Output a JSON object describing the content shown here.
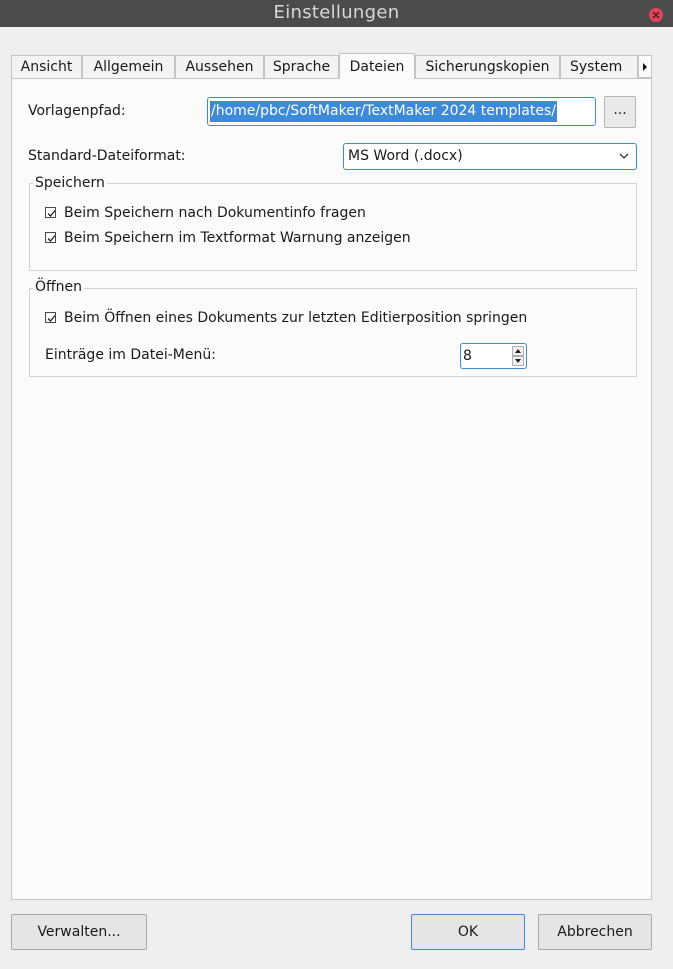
{
  "window": {
    "title": "Einstellungen"
  },
  "tabs": [
    {
      "label": "Ansicht"
    },
    {
      "label": "Allgemein"
    },
    {
      "label": "Aussehen"
    },
    {
      "label": "Sprache"
    },
    {
      "label": "Dateien",
      "active": true
    },
    {
      "label": "Sicherungskopien"
    },
    {
      "label": "System"
    }
  ],
  "files": {
    "template_path_label": "Vorlagenpfad:",
    "template_path_value": "/home/pbc/SoftMaker/TextMaker 2024 templates/",
    "browse_label": "...",
    "default_format_label": "Standard-Dateiformat:",
    "default_format_value": "MS Word (.docx)"
  },
  "save_group": {
    "title": "Speichern",
    "options": [
      {
        "label": "Beim Speichern nach Dokumentinfo fragen",
        "checked": true
      },
      {
        "label": "Beim Speichern im Textformat Warnung anzeigen",
        "checked": true
      }
    ]
  },
  "open_group": {
    "title": "Öffnen",
    "options": [
      {
        "label": "Beim Öffnen eines Dokuments zur letzten Editierposition springen",
        "checked": true
      }
    ],
    "file_menu_entries_label": "Einträge im Datei-Menü:",
    "file_menu_entries_value": "8"
  },
  "footer": {
    "manage_label": "Verwalten...",
    "ok_label": "OK",
    "cancel_label": "Abbrechen"
  },
  "colors": {
    "titlebar": "#4b4b4b",
    "accent": "#3d8bd8",
    "close": "#e0455a"
  }
}
